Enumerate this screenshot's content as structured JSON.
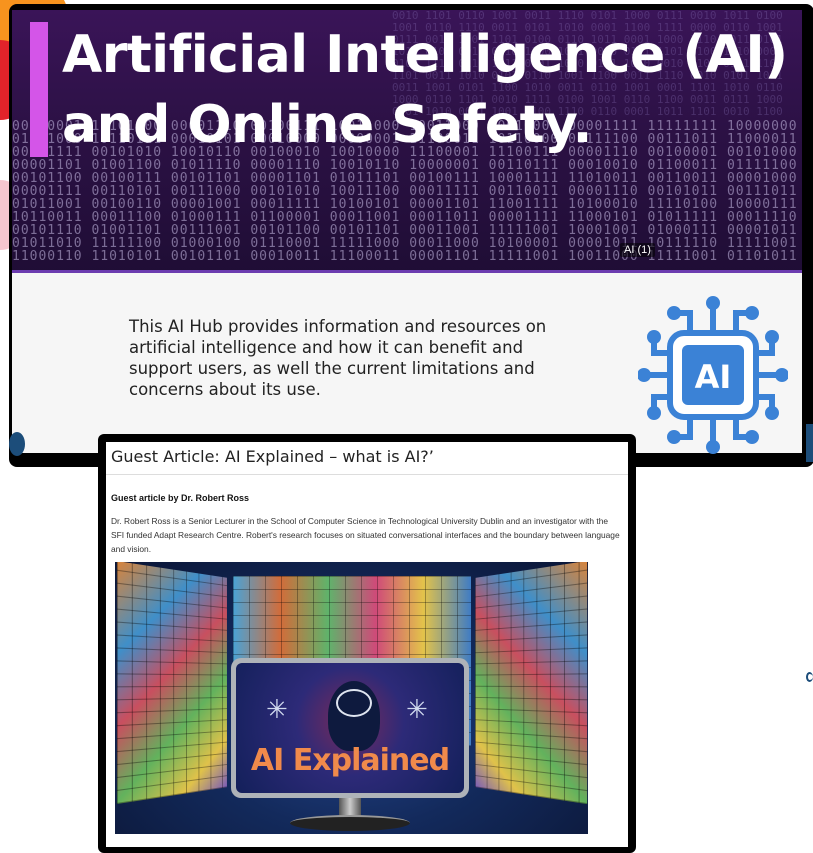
{
  "hero": {
    "title_line1": "Artificial Intelligence (AI)",
    "title_line2": "and Online Safety.",
    "image_tag": "AI (1)",
    "accent_color": "#d455e8"
  },
  "intro": {
    "text": "This AI Hub provides information and resources on artificial intelligence and how it can benefit and support users, as well the current limitations and concerns about its use.",
    "icon_label": "AI",
    "icon_color": "#3b82d6"
  },
  "article": {
    "title": "Guest Article: AI Explained – what is AI?’",
    "byline": "Guest article by Dr. Robert Ross",
    "bio": "Dr. Robert Ross is a Senior Lecturer in the School of Computer Science in Technological University Dublin and an investigator with the SFI funded Adapt Research Centre. Robert's research focuses on situated conversational interfaces and the boundary between language and vision.",
    "image_label": "AI Explained"
  }
}
